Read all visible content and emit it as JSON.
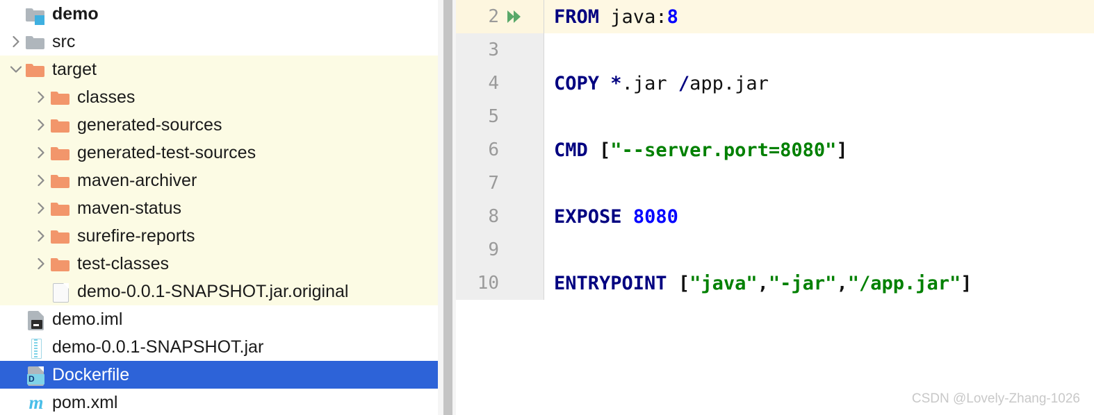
{
  "sidebar": {
    "name": "project-tree",
    "items": [
      {
        "label": "demo",
        "icon": "module-folder-icon",
        "chevron": "none",
        "indent": 0,
        "band": false,
        "selected": false,
        "bold": true
      },
      {
        "label": "src",
        "icon": "folder-gray-icon",
        "chevron": "right",
        "indent": 1,
        "band": false,
        "selected": false,
        "bold": false
      },
      {
        "label": "target",
        "icon": "folder-orange-icon",
        "chevron": "down",
        "indent": 1,
        "band": true,
        "selected": false,
        "bold": false
      },
      {
        "label": "classes",
        "icon": "folder-orange-icon",
        "chevron": "right",
        "indent": 2,
        "band": true,
        "selected": false,
        "bold": false
      },
      {
        "label": "generated-sources",
        "icon": "folder-orange-icon",
        "chevron": "right",
        "indent": 2,
        "band": true,
        "selected": false,
        "bold": false
      },
      {
        "label": "generated-test-sources",
        "icon": "folder-orange-icon",
        "chevron": "right",
        "indent": 2,
        "band": true,
        "selected": false,
        "bold": false
      },
      {
        "label": "maven-archiver",
        "icon": "folder-orange-icon",
        "chevron": "right",
        "indent": 2,
        "band": true,
        "selected": false,
        "bold": false
      },
      {
        "label": "maven-status",
        "icon": "folder-orange-icon",
        "chevron": "right",
        "indent": 2,
        "band": true,
        "selected": false,
        "bold": false
      },
      {
        "label": "surefire-reports",
        "icon": "folder-orange-icon",
        "chevron": "right",
        "indent": 2,
        "band": true,
        "selected": false,
        "bold": false
      },
      {
        "label": "test-classes",
        "icon": "folder-orange-icon",
        "chevron": "right",
        "indent": 2,
        "band": true,
        "selected": false,
        "bold": false
      },
      {
        "label": "demo-0.0.1-SNAPSHOT.jar.original",
        "icon": "file-page-icon",
        "chevron": "none",
        "indent": 2,
        "band": true,
        "selected": false,
        "bold": false
      },
      {
        "label": "demo.iml",
        "icon": "iml-file-icon",
        "chevron": "none",
        "indent": 1,
        "band": false,
        "selected": false,
        "bold": false
      },
      {
        "label": "demo-0.0.1-SNAPSHOT.jar",
        "icon": "jar-file-icon",
        "chevron": "none",
        "indent": 1,
        "band": false,
        "selected": false,
        "bold": false
      },
      {
        "label": "Dockerfile",
        "icon": "dockerfile-icon",
        "chevron": "none",
        "indent": 1,
        "band": false,
        "selected": true,
        "bold": false
      },
      {
        "label": "pom.xml",
        "icon": "maven-pom-icon",
        "chevron": "none",
        "indent": 1,
        "band": false,
        "selected": false,
        "bold": false
      }
    ]
  },
  "editor": {
    "name": "dockerfile-editor",
    "lines": [
      {
        "number": "2",
        "caret": true,
        "run_icon": "run-double-chevron-icon",
        "tokens": [
          {
            "t": "FROM",
            "c": "kw"
          },
          {
            "t": " ",
            "c": "pln"
          },
          {
            "t": "java:",
            "c": "pln"
          },
          {
            "t": "8",
            "c": "num"
          }
        ]
      },
      {
        "number": "3",
        "caret": false,
        "run_icon": "",
        "tokens": []
      },
      {
        "number": "4",
        "caret": false,
        "run_icon": "",
        "tokens": [
          {
            "t": "COPY",
            "c": "kw"
          },
          {
            "t": " ",
            "c": "pln"
          },
          {
            "t": "*",
            "c": "kw"
          },
          {
            "t": ".jar ",
            "c": "pln"
          },
          {
            "t": "/",
            "c": "kw"
          },
          {
            "t": "app.jar",
            "c": "pln"
          }
        ]
      },
      {
        "number": "5",
        "caret": false,
        "run_icon": "",
        "tokens": []
      },
      {
        "number": "6",
        "caret": false,
        "run_icon": "",
        "tokens": [
          {
            "t": "CMD",
            "c": "kw"
          },
          {
            "t": " [",
            "c": "punct"
          },
          {
            "t": "\"--server.port=8080\"",
            "c": "str"
          },
          {
            "t": "]",
            "c": "punct"
          }
        ]
      },
      {
        "number": "7",
        "caret": false,
        "run_icon": "",
        "tokens": []
      },
      {
        "number": "8",
        "caret": false,
        "run_icon": "",
        "tokens": [
          {
            "t": "EXPOSE",
            "c": "kw"
          },
          {
            "t": " ",
            "c": "pln"
          },
          {
            "t": "8080",
            "c": "num"
          }
        ]
      },
      {
        "number": "9",
        "caret": false,
        "run_icon": "",
        "tokens": []
      },
      {
        "number": "10",
        "caret": false,
        "run_icon": "",
        "tokens": [
          {
            "t": "ENTRYPOINT",
            "c": "kw"
          },
          {
            "t": " [",
            "c": "punct"
          },
          {
            "t": "\"java\"",
            "c": "str"
          },
          {
            "t": ",",
            "c": "punct"
          },
          {
            "t": "\"-jar\"",
            "c": "str"
          },
          {
            "t": ",",
            "c": "punct"
          },
          {
            "t": "\"/app.jar\"",
            "c": "str"
          },
          {
            "t": "]",
            "c": "punct"
          }
        ]
      }
    ]
  },
  "watermark": {
    "text": "CSDN @Lovely-Zhang-1026"
  },
  "colors": {
    "selection_blue": "#2D63D8",
    "band_yellow": "#FCFBE4",
    "caret_line": "#FEF8E3",
    "gutter_gray": "#EEEEEE",
    "keyword_navy": "#000080",
    "string_green": "#008000",
    "number_blue": "#0000FF",
    "folder_orange": "#F2966B",
    "folder_gray": "#AFB6BC",
    "scrollbar_gray": "#C4C4C4"
  }
}
